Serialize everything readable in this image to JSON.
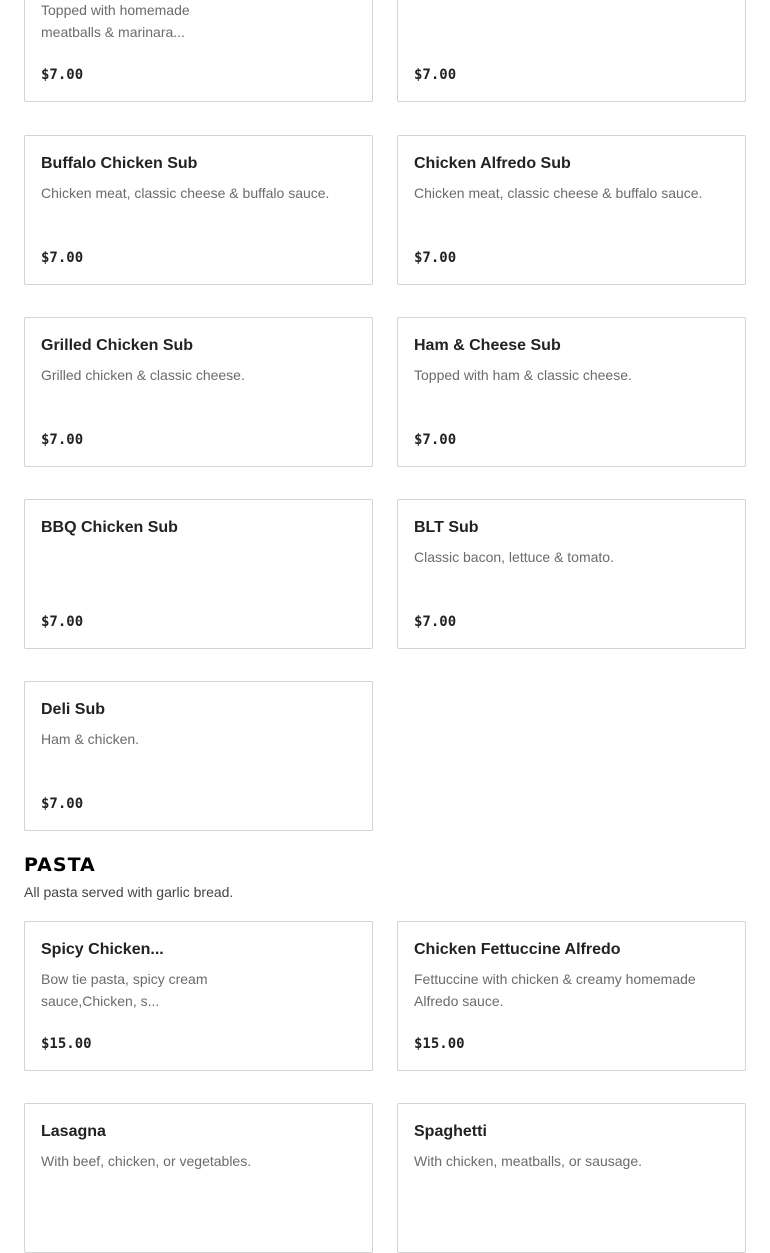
{
  "subs": [
    {
      "name": "",
      "desc": "Topped with homemade meatballs & marinara...",
      "price": "$7.00"
    },
    {
      "name": "",
      "desc": "",
      "price": "$7.00"
    },
    {
      "name": "Buffalo Chicken Sub",
      "desc": "Chicken meat, classic cheese & buffalo sauce.",
      "price": "$7.00"
    },
    {
      "name": "Chicken Alfredo Sub",
      "desc": "Chicken meat, classic cheese & buffalo sauce.",
      "price": "$7.00"
    },
    {
      "name": "Grilled Chicken Sub",
      "desc": "Grilled chicken & classic cheese.",
      "price": "$7.00"
    },
    {
      "name": "Ham & Cheese Sub",
      "desc": "Topped with ham & classic cheese.",
      "price": "$7.00"
    },
    {
      "name": "BBQ Chicken Sub",
      "desc": "",
      "price": "$7.00"
    },
    {
      "name": "BLT Sub",
      "desc": "Classic bacon, lettuce & tomato.",
      "price": "$7.00"
    },
    {
      "name": "Deli Sub",
      "desc": "Ham & chicken.",
      "price": "$7.00"
    }
  ],
  "pasta": {
    "title": "PASTA",
    "subtitle": "All pasta served with garlic bread.",
    "items": [
      {
        "name": "Spicy Chicken...",
        "desc": "Bow tie pasta, spicy cream sauce,Chicken, s...",
        "price": "$15.00"
      },
      {
        "name": "Chicken Fettuccine Alfredo",
        "desc": "Fettuccine with chicken & creamy homemade Alfredo sauce.",
        "price": "$15.00"
      },
      {
        "name": "Lasagna",
        "desc": "With beef, chicken, or vegetables.",
        "price": ""
      },
      {
        "name": "Spaghetti",
        "desc": "With chicken, meatballs, or sausage.",
        "price": ""
      }
    ]
  }
}
